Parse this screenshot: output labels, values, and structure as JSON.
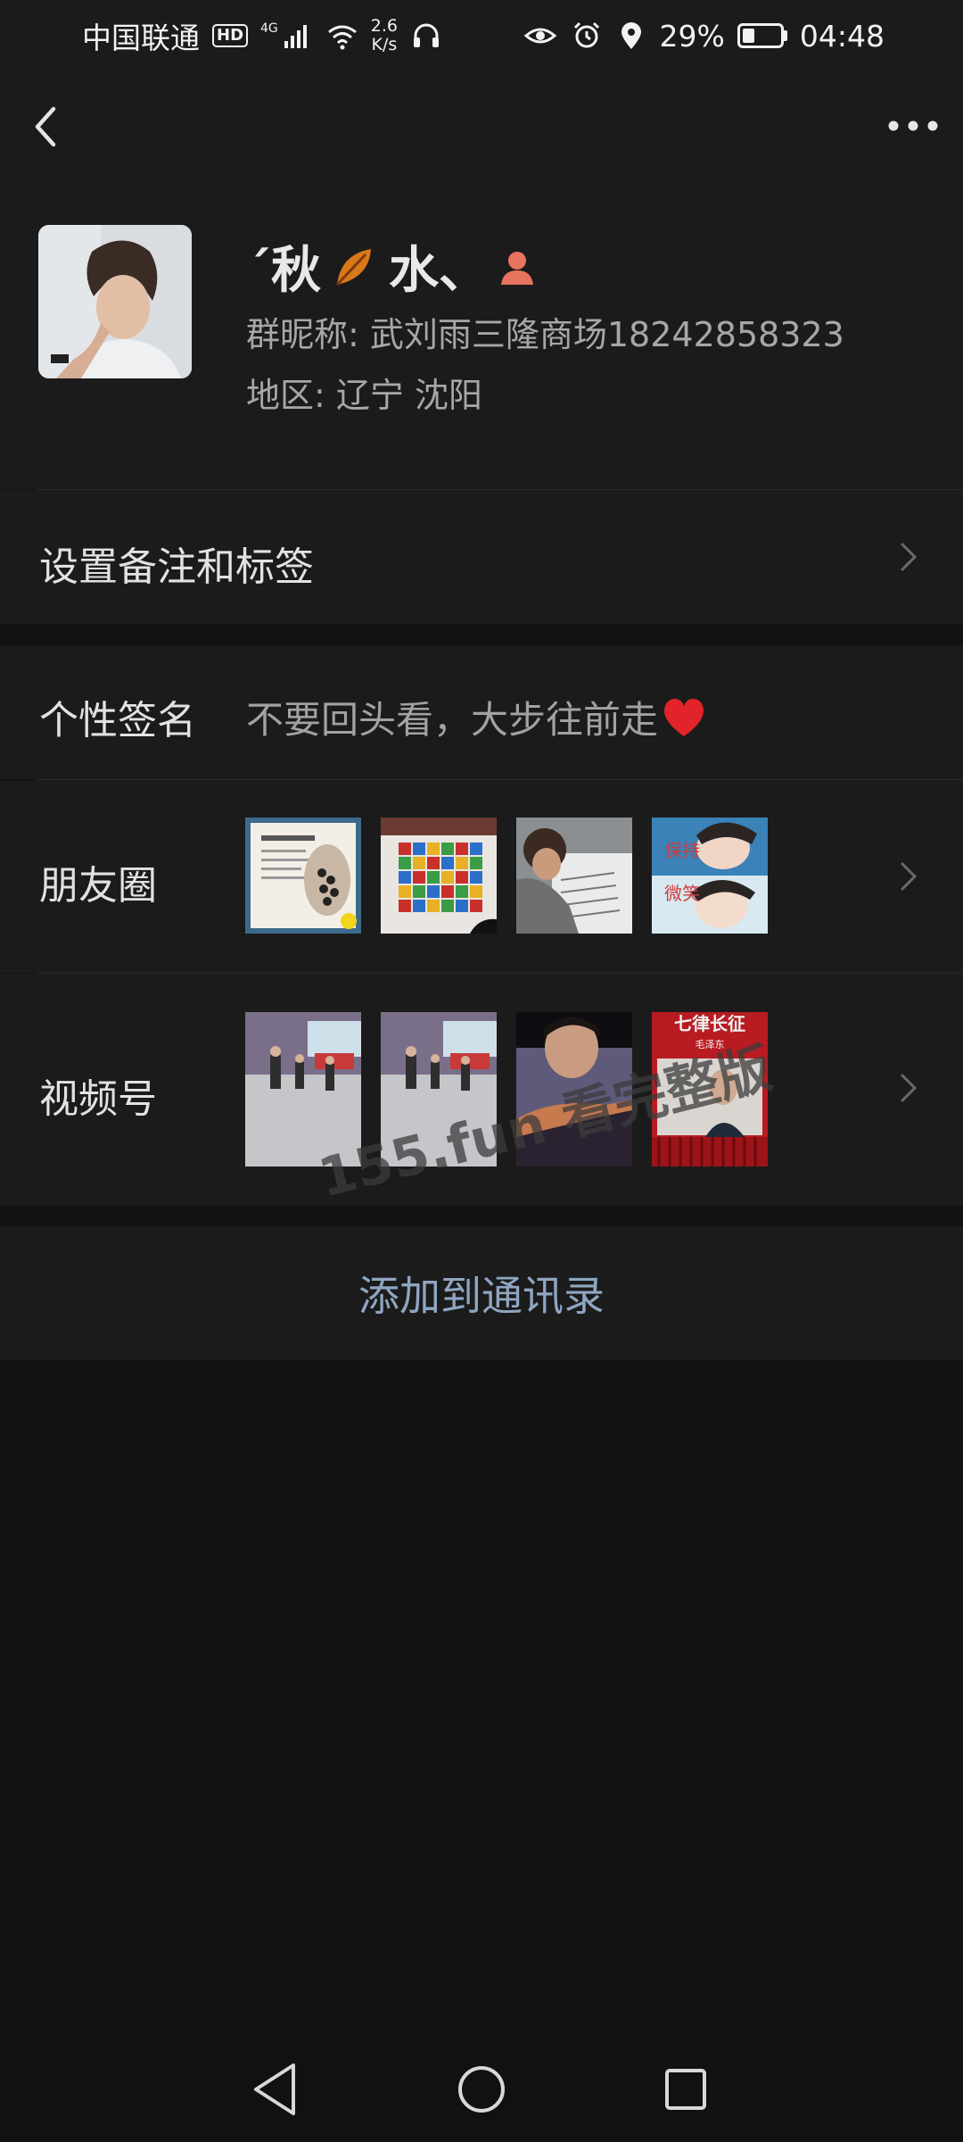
{
  "status_bar": {
    "carrier": "中国联通",
    "hd": "HD",
    "network": "4G",
    "speed_value": "2.6",
    "speed_unit": "K/s",
    "battery": "29%",
    "time": "04:48"
  },
  "profile": {
    "name_part1": "´秋",
    "name_part2": "水、",
    "group_nickname": "群昵称:  武刘雨三隆商场18242858323",
    "region": "地区:  辽宁  沈阳"
  },
  "rows": {
    "remark_label": "设置备注和标签",
    "signature_label": "个性签名",
    "signature_text": "不要回头看，大步往前走",
    "moments_label": "朋友圈",
    "channels_label": "视频号"
  },
  "thumb_text": {
    "moments_4": "保持微笑",
    "channels_4_title": "七律长征",
    "channels_4_sub": "毛泽东"
  },
  "add_contact_label": "添加到通讯录",
  "watermark": "155.fun 看完整版"
}
